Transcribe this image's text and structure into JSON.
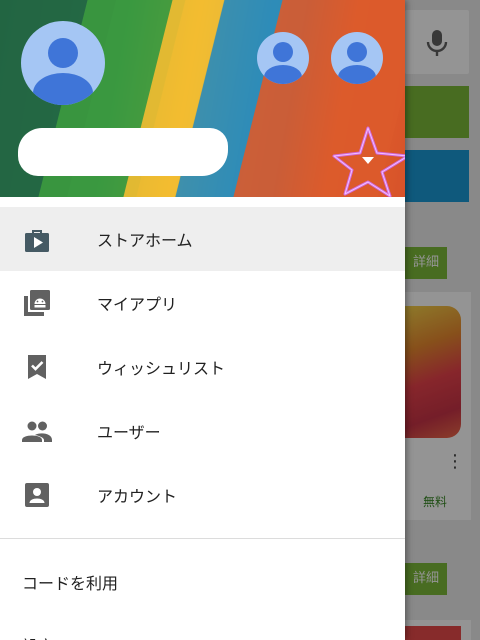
{
  "background": {
    "detail_label": "詳細",
    "free_label": "無料",
    "colors": {
      "green": "#7cbb3a",
      "blue": "#1b9ad6"
    }
  },
  "drawer": {
    "account": {
      "name": ""
    },
    "menu": [
      {
        "label": "ストアホーム",
        "icon": "store-home-icon",
        "active": true
      },
      {
        "label": "マイアプリ",
        "icon": "my-apps-icon",
        "active": false
      },
      {
        "label": "ウィッシュリスト",
        "icon": "wishlist-icon",
        "active": false
      },
      {
        "label": "ユーザー",
        "icon": "people-icon",
        "active": false
      },
      {
        "label": "アカウント",
        "icon": "account-icon",
        "active": false
      }
    ],
    "secondary": [
      {
        "label": "コードを利用"
      },
      {
        "label": "設定"
      }
    ]
  }
}
